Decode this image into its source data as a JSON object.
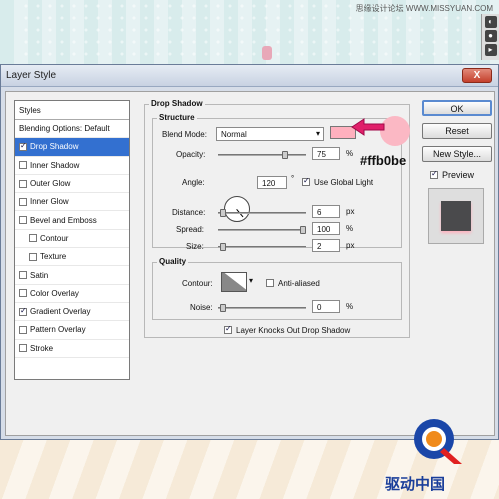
{
  "watermark": "思缘设计论坛  WWW.MISSYUAN.COM",
  "window": {
    "title": "Layer Style",
    "close_label": "X"
  },
  "styles_list": {
    "header": "Styles",
    "items": [
      {
        "label": "Blending Options: Default",
        "checkbox": false,
        "checked": false,
        "active": false,
        "indent": false
      },
      {
        "label": "Drop Shadow",
        "checkbox": true,
        "checked": true,
        "active": true,
        "indent": false
      },
      {
        "label": "Inner Shadow",
        "checkbox": true,
        "checked": false,
        "active": false,
        "indent": false
      },
      {
        "label": "Outer Glow",
        "checkbox": true,
        "checked": false,
        "active": false,
        "indent": false
      },
      {
        "label": "Inner Glow",
        "checkbox": true,
        "checked": false,
        "active": false,
        "indent": false
      },
      {
        "label": "Bevel and Emboss",
        "checkbox": true,
        "checked": false,
        "active": false,
        "indent": false
      },
      {
        "label": "Contour",
        "checkbox": true,
        "checked": false,
        "active": false,
        "indent": true
      },
      {
        "label": "Texture",
        "checkbox": true,
        "checked": false,
        "active": false,
        "indent": true
      },
      {
        "label": "Satin",
        "checkbox": true,
        "checked": false,
        "active": false,
        "indent": false
      },
      {
        "label": "Color Overlay",
        "checkbox": true,
        "checked": false,
        "active": false,
        "indent": false
      },
      {
        "label": "Gradient Overlay",
        "checkbox": true,
        "checked": true,
        "active": false,
        "indent": false
      },
      {
        "label": "Pattern Overlay",
        "checkbox": true,
        "checked": false,
        "active": false,
        "indent": false
      },
      {
        "label": "Stroke",
        "checkbox": true,
        "checked": false,
        "active": false,
        "indent": false
      }
    ]
  },
  "drop_shadow": {
    "title": "Drop Shadow",
    "structure": {
      "title": "Structure",
      "blend_mode_label": "Blend Mode:",
      "blend_mode_value": "Normal",
      "shadow_color": "#ffb0be",
      "opacity_label": "Opacity:",
      "opacity_value": "75",
      "opacity_unit": "%",
      "angle_label": "Angle:",
      "angle_value": "120",
      "angle_unit": "°",
      "global_light_label": "Use Global Light",
      "distance_label": "Distance:",
      "distance_value": "6",
      "distance_unit": "px",
      "spread_label": "Spread:",
      "spread_value": "100",
      "spread_unit": "%",
      "size_label": "Size:",
      "size_value": "2",
      "size_unit": "px"
    },
    "quality": {
      "title": "Quality",
      "contour_label": "Contour:",
      "anti_aliased_label": "Anti-aliased",
      "noise_label": "Noise:",
      "noise_value": "0",
      "noise_unit": "%"
    },
    "knockout_label": "Layer Knocks Out Drop Shadow"
  },
  "annotation": {
    "hex": "#ffb0be"
  },
  "buttons": {
    "ok": "OK",
    "reset": "Reset",
    "new_style": "New Style...",
    "preview": "Preview"
  },
  "logo_text": "驱动中国"
}
